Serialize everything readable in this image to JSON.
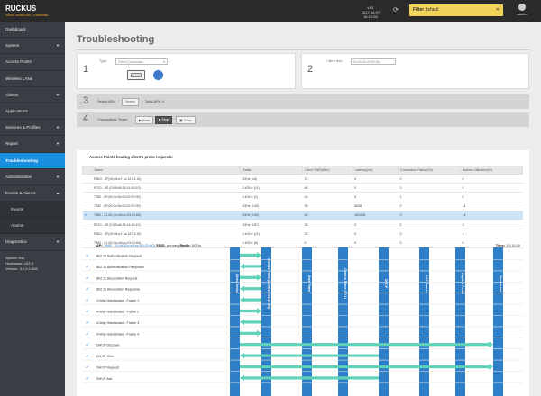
{
  "top": {
    "brand": "RUCKUS",
    "subbrand": "Virtual SmartZone - Essentials",
    "version": "vSZ",
    "datetime": "2017-04-07 16:12:53",
    "filter_label": "Filter",
    "filter_value": "default",
    "user": "admin"
  },
  "sidebar": {
    "items": [
      {
        "label": "Dashboard",
        "chev": ""
      },
      {
        "label": "System",
        "chev": "▼"
      },
      {
        "label": "Access Points",
        "chev": ""
      },
      {
        "label": "Wireless LANs",
        "chev": ""
      },
      {
        "label": "Clients",
        "chev": "▼"
      },
      {
        "label": "Applications",
        "chev": ""
      },
      {
        "label": "Services & Profiles",
        "chev": "▼"
      },
      {
        "label": "Report",
        "chev": "▼"
      },
      {
        "label": "Troubleshooting",
        "chev": ""
      },
      {
        "label": "Administration",
        "chev": "▼"
      },
      {
        "label": "Events & Alarms",
        "chev": "▲"
      }
    ],
    "subitems": [
      "Events",
      "Alarms"
    ],
    "after": [
      {
        "label": "Diagnostics",
        "chev": "▼"
      }
    ],
    "sysinfo": {
      "title": "System Info",
      "hostname_label": "Hostname:",
      "hostname": "vSZ-E",
      "version_label": "Version:",
      "version": "3.5.0.0.808"
    },
    "active": 8
  },
  "main": {
    "title": "Troubleshooting",
    "step1": {
      "num": "1",
      "type_label": "Type:",
      "type_value": "Client Connection",
      "picker_text": "Select..."
    },
    "step2": {
      "num": "2",
      "time_label": "Client test:",
      "time_value": "04-06-05 20:59:06"
    },
    "step3": {
      "num": "3",
      "label": "Select APs:",
      "button": "Select",
      "total": "Total APs: 4"
    },
    "step4": {
      "num": "4",
      "label": "Connectivity Trace:",
      "start": "Start",
      "stop": "Stop",
      "clear": "Clear"
    },
    "probe_heading": "Access Points hearing client's probe requests:",
    "columns": [
      "",
      "Name",
      "Radio",
      "Client SNR(dBm)",
      "Latency(ms)",
      "Connection Failure(%)",
      "Airtime Utilization(%)"
    ],
    "rows": [
      {
        "check": "",
        "name": "R510 - 3F(10:d8:a7:1a:12:51:10)",
        "radio": "5GHz (44)",
        "snr": "13",
        "lat": "0",
        "fail": "0",
        "air": "0"
      },
      {
        "check": "",
        "name": "R710 - 4S (0:58:b6:33:14:45:10)",
        "radio": "2.4GHz (11)",
        "snr": "60",
        "lat": "0",
        "fail": "0",
        "air": "4"
      },
      {
        "check": "",
        "name": "7782 - 9F(00:2c:5d:93:22:97:00)",
        "radio": "2.4GHz (1)",
        "snr": "24",
        "lat": "0",
        "fail": "1",
        "air": "0"
      },
      {
        "check": "",
        "name": "7782 - 9F(00:2c:5d:93:22:97:00)",
        "radio": "5GHz (149)",
        "snr": "39",
        "lat": "5538",
        "fail": "0",
        "air": "14"
      },
      {
        "check": "✔",
        "name": "7982 - 21-60 (2c:e6:cc:03:21:60)",
        "radio": "5GHz (149)",
        "snr": "40",
        "lat": "162048",
        "fail": "0",
        "air": "14"
      },
      {
        "check": "",
        "name": "R710 - 4S (0:58:b6:33:14:45:10)",
        "radio": "5GHz (157)",
        "snr": "35",
        "lat": "0",
        "fail": "0",
        "air": "3"
      },
      {
        "check": "",
        "name": "R510 - 3F(10:d8:a7:1a:12:51:10)",
        "radio": "2.4GHz (11)",
        "snr": "22",
        "lat": "0",
        "fail": "0",
        "air": "1"
      },
      {
        "check": "",
        "name": "7982 - 21-60 (2c:e6:cc:03:21:60)",
        "radio": "2.4GHz (6)",
        "snr": "0",
        "lat": "0",
        "fail": "0",
        "air": "0"
      }
    ],
    "apline": {
      "ap_label": "AP:",
      "ap_value": "7982 - 21-60(2c:e6:cc:03:21:60)",
      "ssid_label": "SSID:",
      "ssid_value": "primary",
      "radio_label": "Radio:",
      "radio_value": "5GHz",
      "time_label": "Time:",
      "time_value": "16:12:40"
    },
    "lanes": [
      "Client Device",
      "Access Point (2c:e6:cc:03:21:60)",
      "Data Plane",
      "Control Plane (10.1)",
      "DHCP",
      "AAA Server",
      "Captive Portal",
      "Broadcast"
    ],
    "events": [
      {
        "label": "802.11 Authentication Request",
        "from": 0,
        "to": 1
      },
      {
        "label": "802.11 Authentication Response",
        "from": 1,
        "to": 0
      },
      {
        "label": "802.11 Association Request",
        "from": 0,
        "to": 1
      },
      {
        "label": "802.11 Association Response",
        "from": 1,
        "to": 0
      },
      {
        "label": "4-Way Handshake - Frame 1",
        "from": 1,
        "to": 0
      },
      {
        "label": "4-Way Handshake - Frame 2",
        "from": 0,
        "to": 1
      },
      {
        "label": "4-Way Handshake - Frame 3",
        "from": 1,
        "to": 0
      },
      {
        "label": "4-Way Handshake - Frame 4",
        "from": 0,
        "to": 1
      },
      {
        "label": "DHCP Discover",
        "from": 0,
        "to": 7
      },
      {
        "label": "DHCP Offer",
        "from": 4,
        "to": 0
      },
      {
        "label": "DHCP Request",
        "from": 0,
        "to": 7
      },
      {
        "label": "DHCP Ack",
        "from": 4,
        "to": 0
      }
    ],
    "colors": {
      "lane": "#2f7fc8",
      "arrow": "#5fd1b8",
      "check": "#1a6fc4"
    }
  }
}
